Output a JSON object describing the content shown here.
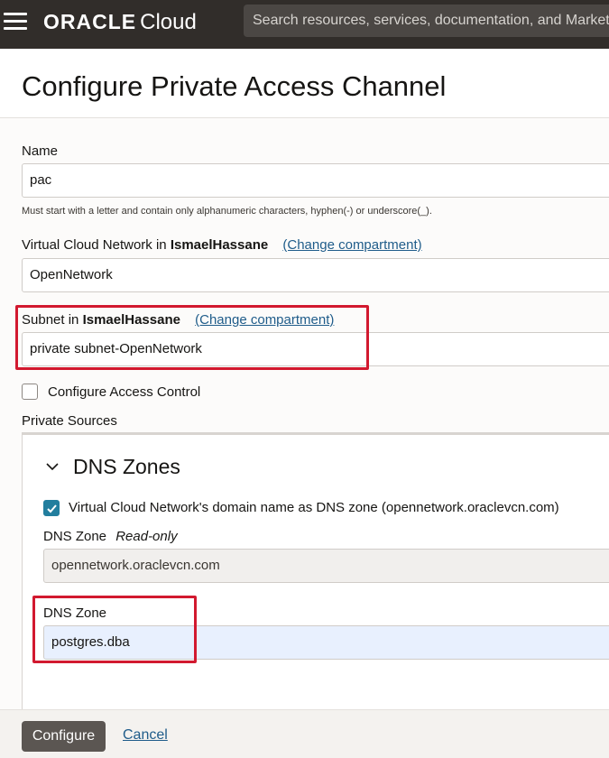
{
  "topbar": {
    "logo_brand": "ORACLE",
    "logo_product": "Cloud",
    "search_placeholder": "Search resources, services, documentation, and Marketplace"
  },
  "page": {
    "title": "Configure Private Access Channel"
  },
  "form": {
    "name": {
      "label": "Name",
      "value": "pac",
      "hint": "Must start with a letter and contain only alphanumeric characters, hyphen(-) or underscore(_)."
    },
    "vcn": {
      "label_prefix": "Virtual Cloud Network in",
      "compartment": "IsmaelHassane",
      "change_link": "(Change compartment)",
      "value": "OpenNetwork"
    },
    "subnet": {
      "label_prefix": "Subnet in",
      "compartment": "IsmaelHassane",
      "change_link": "(Change compartment)",
      "value": "private subnet-OpenNetwork"
    },
    "access_control": {
      "label": "Configure Access Control",
      "checked": false
    },
    "private_sources_label": "Private Sources",
    "dns": {
      "section_title": "DNS Zones",
      "vcn_domain_checkbox_label": "Virtual Cloud Network's domain name as DNS zone (opennetwork.oraclevcn.com)",
      "vcn_domain_checked": true,
      "readonly_zone_label": "DNS Zone",
      "readonly_tag": "Read-only",
      "readonly_zone_value": "opennetwork.oraclevcn.com",
      "zone_label": "DNS Zone",
      "zone_value": "postgres.dba"
    }
  },
  "footer": {
    "configure_label": "Configure",
    "cancel_label": "Cancel"
  },
  "colors": {
    "highlight": "#d2192f",
    "link": "#1f5c8a",
    "checkbox": "#227e9e",
    "topbar": "#312d2a"
  }
}
